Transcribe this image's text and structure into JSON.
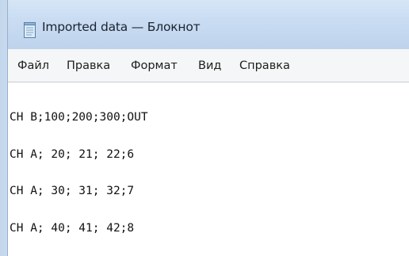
{
  "window": {
    "title": "Imported data — Блокнот",
    "icon": "notepad-icon"
  },
  "menu": {
    "items": [
      {
        "label": "Файл"
      },
      {
        "label": "Правка"
      },
      {
        "label": "Формат"
      },
      {
        "label": "Вид"
      },
      {
        "label": "Справка"
      }
    ]
  },
  "document": {
    "lines": [
      "CH B;100;200;300;OUT",
      "CH A; 20; 21; 22;6",
      "CH A; 30; 31; 32;7",
      "CH A; 40; 41; 42;8"
    ]
  }
}
